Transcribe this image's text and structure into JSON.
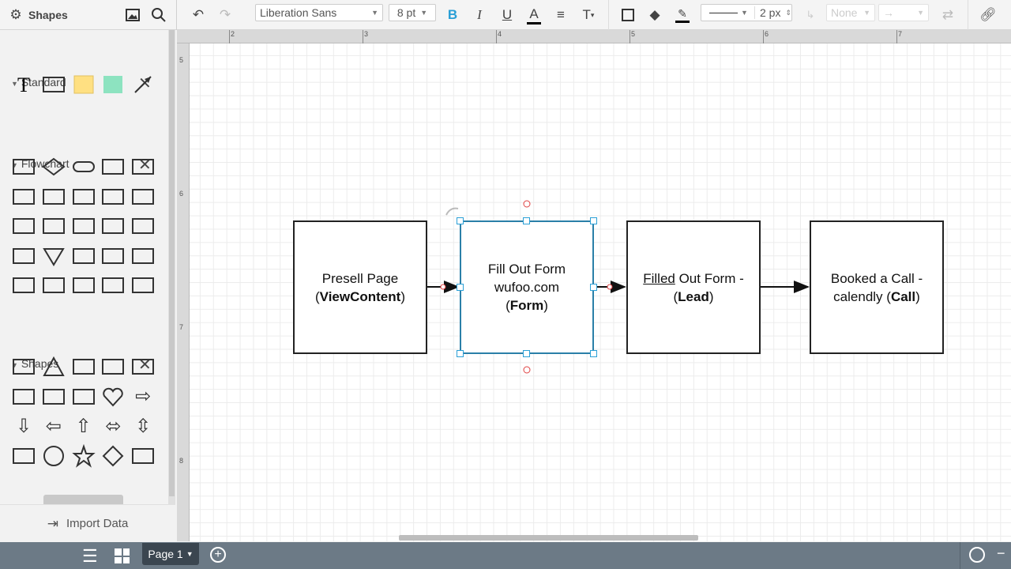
{
  "toolbar": {
    "panel_title": "Shapes",
    "font_family": "Liberation Sans",
    "font_size": "8 pt",
    "line_width": "2 px",
    "arrow_start": "None",
    "bold_color": "#2a9fd6",
    "icons": [
      "gear-icon",
      "image-icon",
      "search-icon",
      "undo-icon",
      "redo-icon",
      "bold-icon",
      "italic-icon",
      "underline-icon",
      "text-color-icon",
      "align-icon",
      "text-options-icon",
      "border-icon",
      "fill-icon",
      "line-color-icon",
      "line-style-icon",
      "connector-icon",
      "arrow-end-icon",
      "swap-icon",
      "link-icon"
    ]
  },
  "sidebar": {
    "sections": [
      {
        "title": "Standard",
        "shapes": [
          "text",
          "rectangle",
          "note",
          "block",
          "arrow-line"
        ]
      },
      {
        "title": "Flowchart",
        "shapes": [
          "process",
          "decision",
          "terminator",
          "predefined-process",
          "document",
          "display",
          "manual-input",
          "preparation",
          "data",
          "database",
          "stored-data",
          "internal-storage",
          "tape",
          "manual-operation",
          "delay",
          "off-page",
          "merge",
          "connector",
          "or",
          "summing-junction",
          "display-alt",
          "off-page-reference",
          "brace-note",
          "bracket-note",
          "annotation"
        ]
      },
      {
        "title": "Shapes",
        "shapes": [
          "rectangle",
          "triangle",
          "right-triangle",
          "pentagon",
          "hexagon",
          "octagon",
          "cross",
          "cloud",
          "heart",
          "arrow-right",
          "arrow-down",
          "arrow-left",
          "arrow-up",
          "arrow-left-right",
          "arrow-up-down",
          "callout",
          "circle",
          "star",
          "diamond",
          "pentagon-alt"
        ]
      }
    ],
    "import_label": "Import Data"
  },
  "ruler": {
    "top": [
      "2",
      "3",
      "4",
      "5",
      "6",
      "7"
    ],
    "left": [
      "5",
      "6",
      "7",
      "8"
    ]
  },
  "diagram": {
    "boxes": [
      {
        "lines": [
          [
            "Presell Page"
          ],
          [
            "(",
            "ViewContent",
            ")"
          ]
        ]
      },
      {
        "lines": [
          [
            "Fill Out Form"
          ],
          [
            "wufoo.com"
          ],
          [
            "(",
            "Form",
            ")"
          ]
        ]
      },
      {
        "lines": [
          [
            "Filled",
            " Out Form -"
          ],
          [
            "(",
            "Lead",
            ")"
          ]
        ]
      },
      {
        "lines": [
          [
            "Booked a Call -"
          ],
          [
            "calendly (",
            "Call",
            ")"
          ]
        ]
      }
    ],
    "selection_color": "#2a9fd6"
  },
  "footer": {
    "page_label": "Page 1"
  }
}
